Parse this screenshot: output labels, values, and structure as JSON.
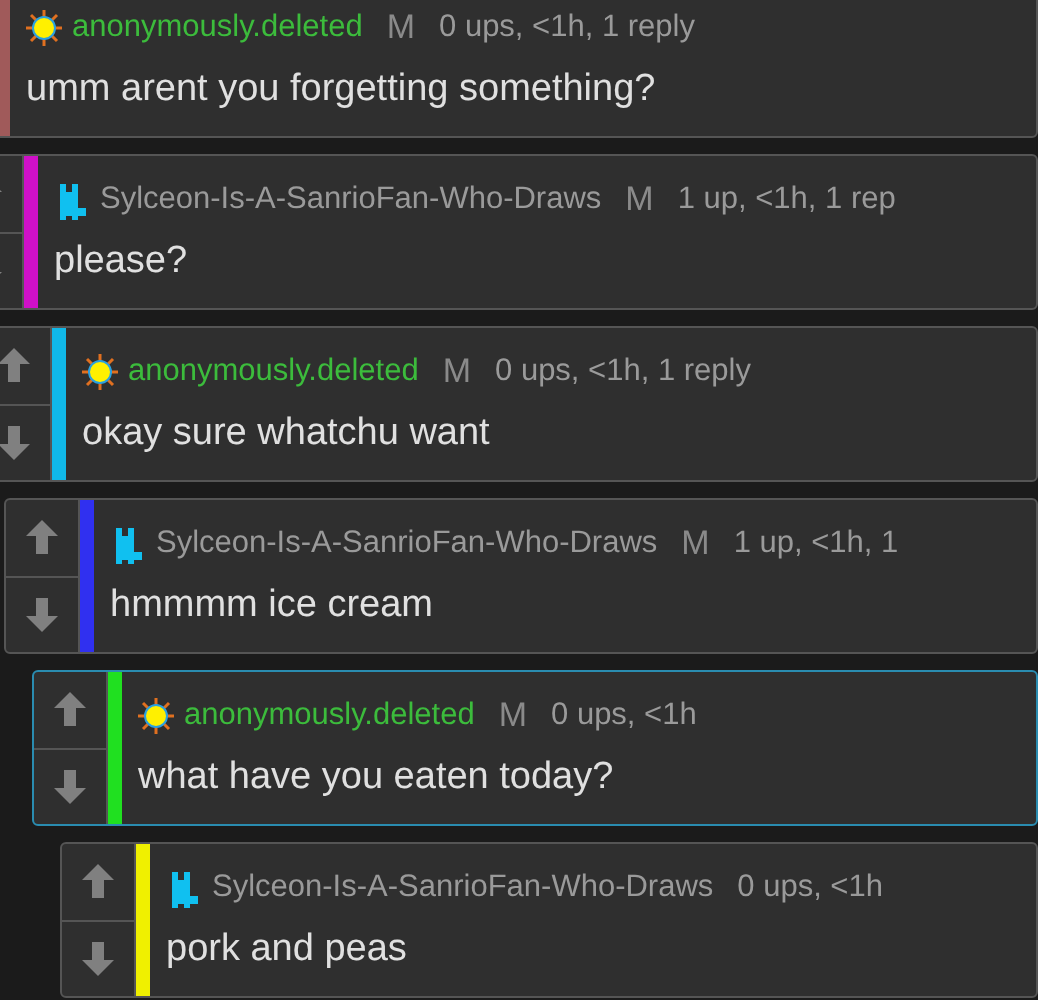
{
  "comments": [
    {
      "kind": "deleted",
      "user": "anonymously.deleted",
      "badge": "M",
      "meta": "0 ups, <1h, 1 reply",
      "text": "umm arent you forgetting something?",
      "color": "#a05a5a",
      "highlighted": false,
      "children": [
        {
          "kind": "member",
          "user": "Sylceon-Is-A-SanrioFan-Who-Draws",
          "badge": "M",
          "meta": "1 up, <1h, 1 rep",
          "text": "please?",
          "color": "#d010c8",
          "highlighted": false,
          "children": [
            {
              "kind": "deleted",
              "user": "anonymously.deleted",
              "badge": "M",
              "meta": "0 ups, <1h, 1 reply",
              "text": "okay sure whatchu want",
              "color": "#10b8e8",
              "highlighted": false,
              "children": [
                {
                  "kind": "member",
                  "user": "Sylceon-Is-A-SanrioFan-Who-Draws",
                  "badge": "M",
                  "meta": "1 up, <1h, 1",
                  "text": "hmmmm ice cream",
                  "color": "#3030f0",
                  "highlighted": false,
                  "children": [
                    {
                      "kind": "deleted",
                      "user": "anonymously.deleted",
                      "badge": "M",
                      "meta": "0 ups, <1h",
                      "text": "what have you eaten today?",
                      "color": "#20e020",
                      "highlighted": true,
                      "children": [
                        {
                          "kind": "member",
                          "user": "Sylceon-Is-A-SanrioFan-Who-Draws",
                          "meta": "0 ups, <1h",
                          "text": "pork and peas",
                          "color": "#f0f000",
                          "highlighted": false
                        }
                      ]
                    }
                  ]
                }
              ]
            }
          ]
        }
      ]
    }
  ]
}
